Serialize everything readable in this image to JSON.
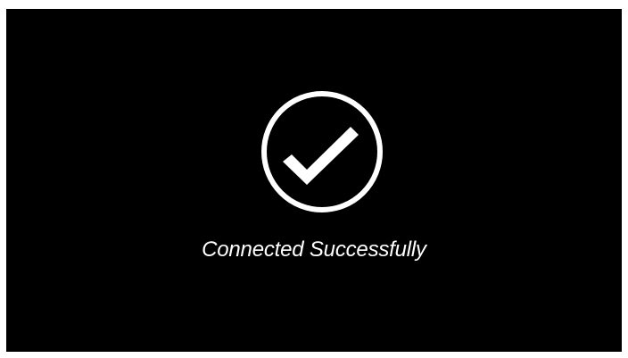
{
  "screen": {
    "background_color": "#000000",
    "foreground_color": "#ffffff",
    "icon": "checkmark-circle-icon",
    "status_message": "Connected Successfully"
  }
}
